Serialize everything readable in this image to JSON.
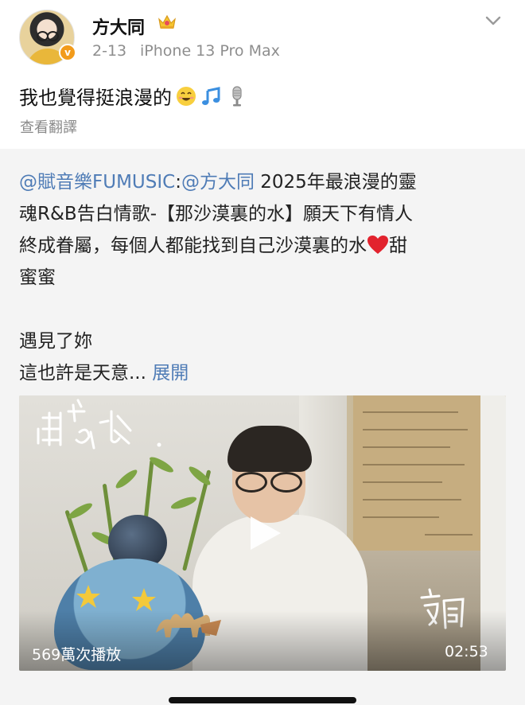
{
  "post": {
    "username": "方大同",
    "time": "2-13",
    "device": "iPhone 13 Pro Max",
    "text": "我也覺得挺浪漫的",
    "emojis": [
      "smiling-face-icon",
      "music-note-icon",
      "microphone-icon"
    ],
    "translate_label": "查看翻譯"
  },
  "repost": {
    "mention": "@賦音樂FUMUSIC",
    "separator": ":",
    "mention2": "@方大同",
    "line1_rest": " 2025年最浪漫的靈",
    "line2": "魂R&B告白情歌-【那沙漠裏的水】願天下有情人",
    "line3_before": "終成眷屬，每個人都能找到自己沙漠裏的水",
    "line3_after": "甜",
    "line4": "蜜蜜",
    "line5": "遇見了妳",
    "line6": "這也許是天意...",
    "expand_label": "展開"
  },
  "video": {
    "play_count": "569萬次播放",
    "duration": "02:53"
  },
  "colors": {
    "link": "#4f7cb6",
    "verify_badge": "#f29b1b",
    "repost_background": "#f4f4f4"
  }
}
